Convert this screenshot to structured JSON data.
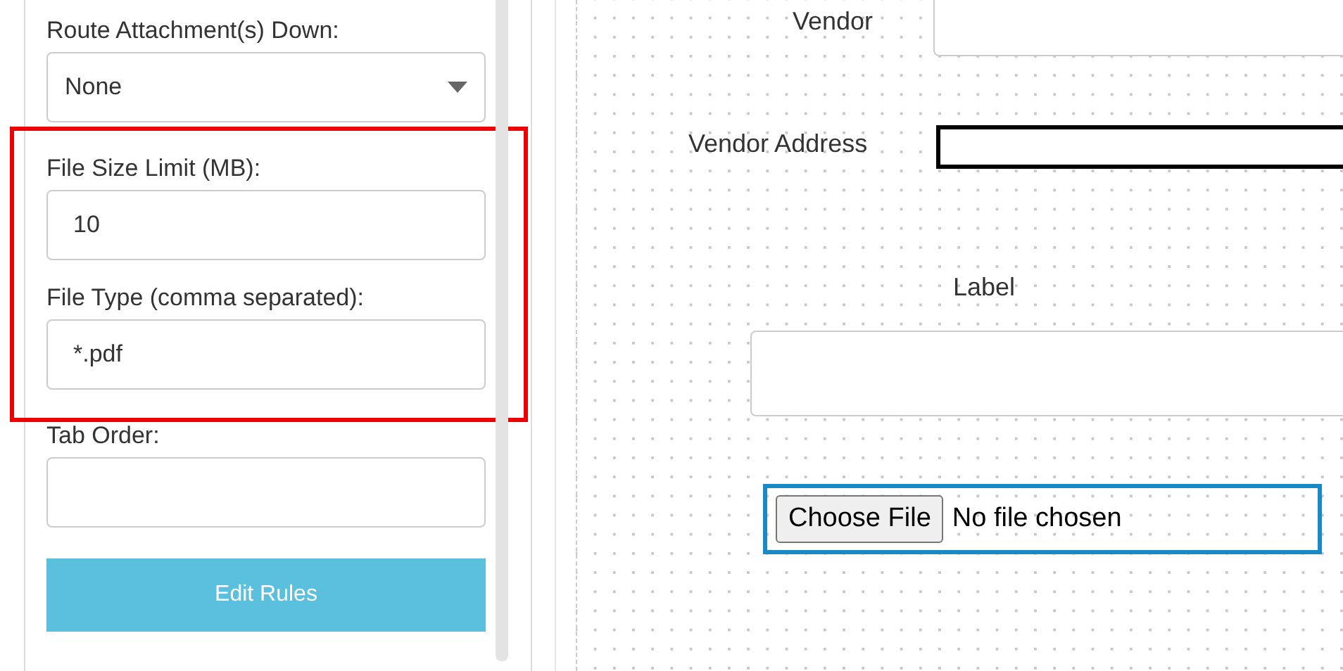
{
  "sidebar": {
    "fields": [
      {
        "kind": "select",
        "label": "Route Attachment(s) Down:",
        "value": "None",
        "highlighted": false
      },
      {
        "kind": "text",
        "label": "File Size Limit (MB):",
        "value": "10",
        "highlighted": true
      },
      {
        "kind": "text",
        "label": "File Type (comma separated):",
        "value": "*.pdf",
        "highlighted": true
      },
      {
        "kind": "text",
        "label": "Tab Order:",
        "highlighted": false
      }
    ],
    "button": "Edit Rules"
  },
  "canvas": {
    "elements": [
      {
        "kind": "text",
        "label": "Vendor",
        "selected": false
      },
      {
        "kind": "text",
        "label": "Vendor Address",
        "selected": true
      },
      {
        "kind": "textarea",
        "label": "Label",
        "selected": false
      },
      {
        "kind": "file",
        "button": "Choose File",
        "status": "No file chosen"
      }
    ]
  }
}
